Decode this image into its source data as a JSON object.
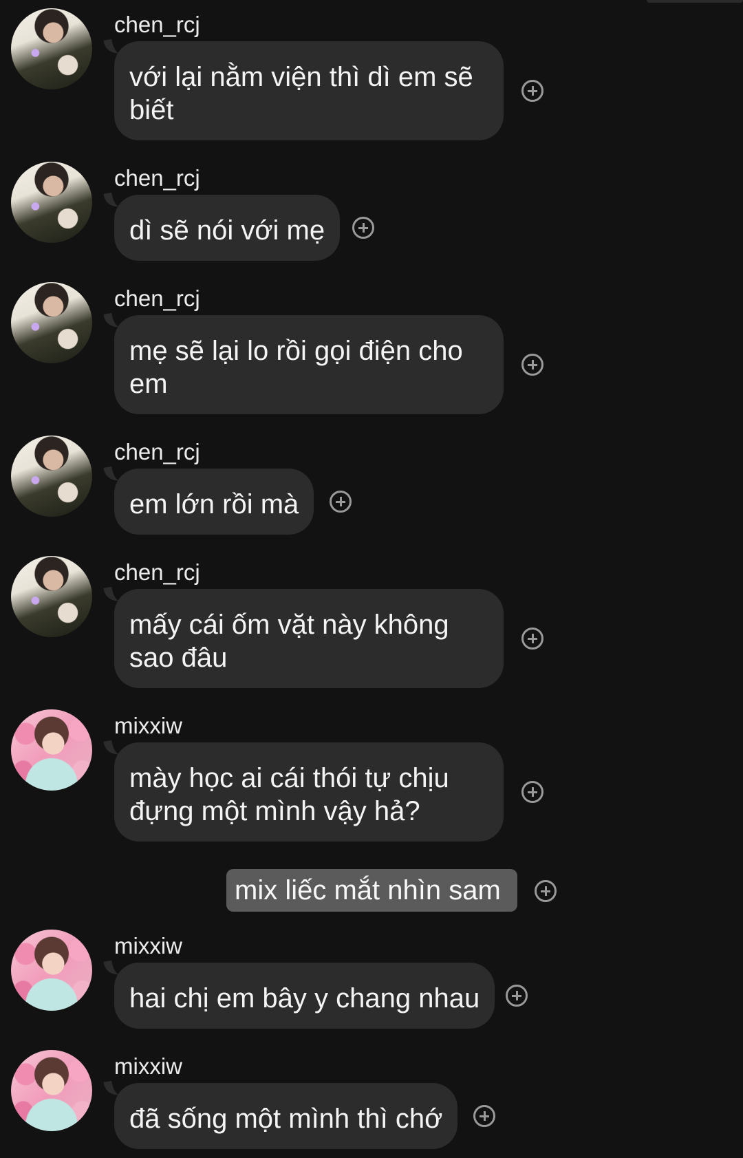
{
  "messages": [
    {
      "sender": "chen_rcj",
      "avatar": "chen",
      "text": "với lại nằm viện thì dì em sẽ biết"
    },
    {
      "sender": "chen_rcj",
      "avatar": "chen",
      "text": "dì sẽ nói với mẹ"
    },
    {
      "sender": "chen_rcj",
      "avatar": "chen",
      "text": "mẹ sẽ lại lo rồi gọi điện cho em"
    },
    {
      "sender": "chen_rcj",
      "avatar": "chen",
      "text": "em lớn rồi mà"
    },
    {
      "sender": "chen_rcj",
      "avatar": "chen",
      "text": "mấy cái ốm vặt này không sao đâu"
    },
    {
      "sender": "mixxiw",
      "avatar": "mix",
      "text": "mày học ai cái thói tự chịu đựng một mình vậy hả?"
    },
    {
      "sender": "mixxiw",
      "avatar": "mix",
      "text": "hai chị em bây y chang nhau"
    },
    {
      "sender": "mixxiw",
      "avatar": "mix",
      "text": "đã sống một mình thì chớ"
    }
  ],
  "narration": {
    "text": "mix liếc mắt nhìn sam"
  },
  "icons": {
    "react": "add-reaction-icon"
  },
  "colors": {
    "background": "#121212",
    "bubble": "#2c2c2c",
    "narration_bg": "#5b5b5b",
    "icon": "#9a9a9a"
  }
}
